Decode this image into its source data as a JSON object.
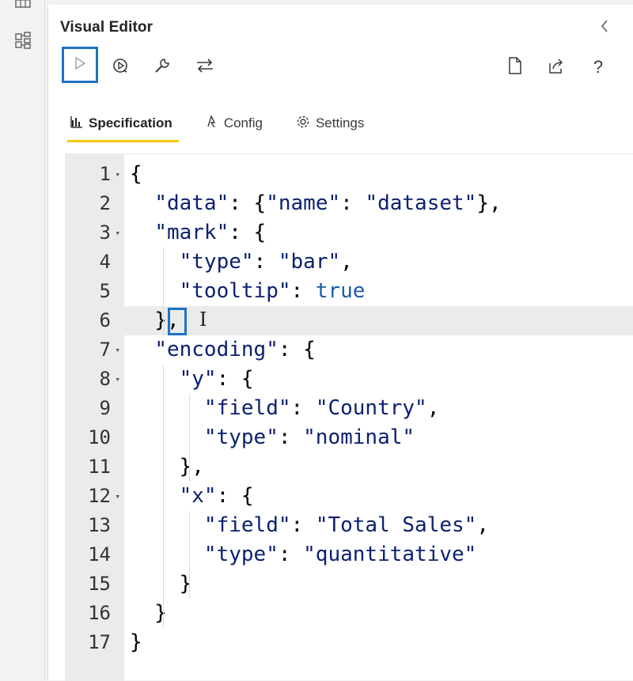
{
  "left_rail": {
    "icons": [
      "table-icon",
      "model-icon"
    ]
  },
  "panel": {
    "title": "Visual Editor"
  },
  "toolbar": {
    "left": [
      "run-icon",
      "auto-apply-icon",
      "repair-icon",
      "map-fields-icon"
    ],
    "right": [
      "new-spec-icon",
      "export-icon",
      "help-icon"
    ]
  },
  "tabs": [
    {
      "label": "Specification",
      "icon": "bar-chart-icon",
      "active": true
    },
    {
      "label": "Config",
      "icon": "config-icon",
      "active": false
    },
    {
      "label": "Settings",
      "icon": "gear-icon",
      "active": false
    }
  ],
  "editor": {
    "active_line": 6,
    "lines": [
      {
        "n": "1",
        "fold": true,
        "text": "{"
      },
      {
        "n": "2",
        "fold": false,
        "text": "  \"data\": {\"name\": \"dataset\"},"
      },
      {
        "n": "3",
        "fold": true,
        "text": "  \"mark\": {"
      },
      {
        "n": "4",
        "fold": false,
        "text": "    \"type\": \"bar\","
      },
      {
        "n": "5",
        "fold": false,
        "text": "    \"tooltip\": true"
      },
      {
        "n": "6",
        "fold": false,
        "text": "  },"
      },
      {
        "n": "7",
        "fold": true,
        "text": "  \"encoding\": {"
      },
      {
        "n": "8",
        "fold": true,
        "text": "    \"y\": {"
      },
      {
        "n": "9",
        "fold": false,
        "text": "      \"field\": \"Country\","
      },
      {
        "n": "10",
        "fold": false,
        "text": "      \"type\": \"nominal\""
      },
      {
        "n": "11",
        "fold": false,
        "text": "    },"
      },
      {
        "n": "12",
        "fold": true,
        "text": "    \"x\": {"
      },
      {
        "n": "13",
        "fold": false,
        "text": "      \"field\": \"Total Sales\","
      },
      {
        "n": "14",
        "fold": false,
        "text": "      \"type\": \"quantitative\""
      },
      {
        "n": "15",
        "fold": false,
        "text": "    }"
      },
      {
        "n": "16",
        "fold": false,
        "text": "  }"
      },
      {
        "n": "17",
        "fold": false,
        "text": "}"
      }
    ]
  },
  "colors": {
    "accent_tab": "#f2c811",
    "highlight_box": "#1e72c4",
    "string_color": "#0b216f",
    "boolean_color": "#1a5ba8"
  }
}
